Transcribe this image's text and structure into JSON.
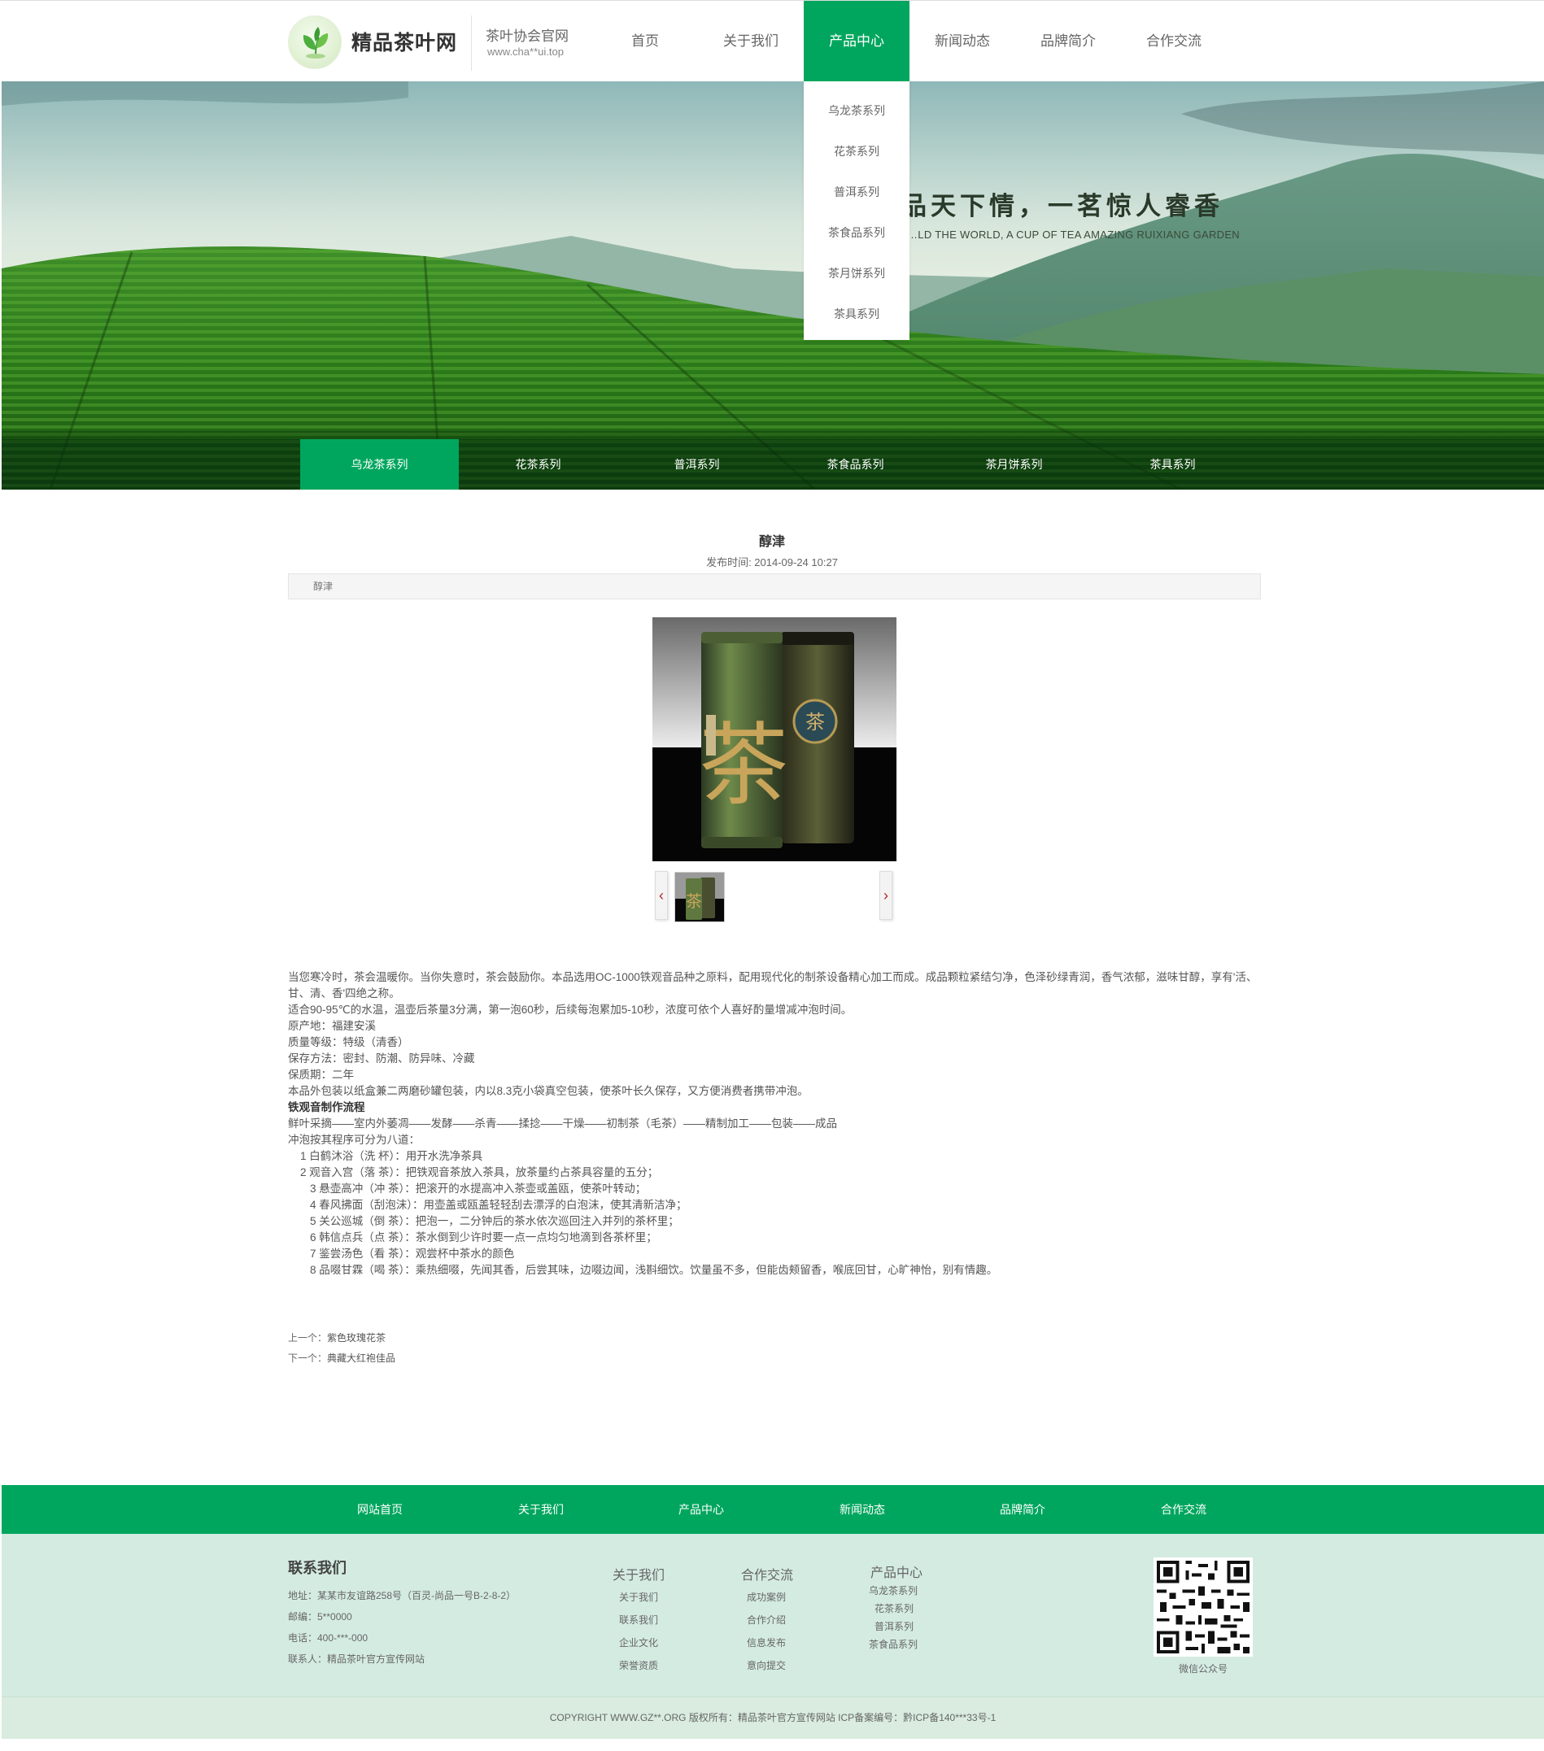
{
  "header": {
    "brand": "精品茶叶网",
    "association": "茶叶协会官网",
    "domain": "www.cha**ui.top",
    "nav": [
      {
        "label": "首页",
        "active": false
      },
      {
        "label": "关于我们",
        "active": false
      },
      {
        "label": "产品中心",
        "active": true
      },
      {
        "label": "新闻动态",
        "active": false
      },
      {
        "label": "品牌简介",
        "active": false
      },
      {
        "label": "合作交流",
        "active": false
      }
    ],
    "dropdown": [
      "乌龙茶系列",
      "花茶系列",
      "普洱系列",
      "茶食品系列",
      "茶月饼系列",
      "茶具系列"
    ]
  },
  "banner": {
    "slogan": "品天下情，一茗惊人睿香",
    "slogan_en": "…LD THE WORLD, A CUP OF TEA AMAZING RUIXIANG GARDEN",
    "categories": [
      {
        "label": "乌龙茶系列",
        "active": true
      },
      {
        "label": "花茶系列",
        "active": false
      },
      {
        "label": "普洱系列",
        "active": false
      },
      {
        "label": "茶食品系列",
        "active": false
      },
      {
        "label": "茶月饼系列",
        "active": false
      },
      {
        "label": "茶具系列",
        "active": false
      }
    ]
  },
  "article": {
    "title": "醇津",
    "date_label": "发布时间: 2014-09-24 10:27",
    "breadcrumb": "醇津",
    "prev_arrow": "‹",
    "next_arrow": "›",
    "paragraphs": [
      "当您寒冷时，茶会温暖你。当你失意时，茶会鼓励你。本品选用OC-1000铁观音品种之原料，配用现代化的制茶设备精心加工而成。成品颗粒紧结匀净，色泽砂绿青润，香气浓郁，滋味甘醇，享有'活、甘、清、香'四绝之称。",
      "适合90-95℃的水温，温壶后茶量3分满，第一泡60秒，后续每泡累加5-10秒，浓度可依个人喜好酌量增减冲泡时间。",
      "原产地：福建安溪",
      "质量等级：特级（清香）",
      "保存方法：密封、防潮、防异味、冷藏",
      "保质期：二年",
      "本品外包装以纸盒兼二两磨砂罐包装，内以8.3克小袋真空包装，使茶叶长久保存，又方便消费者携带冲泡。"
    ],
    "process_title": "铁观音制作流程",
    "process_steps": "鲜叶采摘——室内外萎凋——发酵——杀青——揉捻——干燥——初制茶（毛茶）——精制加工——包装——成品",
    "brew_intro": "冲泡按其程序可分为八道：",
    "brew_steps": [
      "1 白鹤沐浴（洗 杯）：用开水洗净茶具",
      "2 观音入宫（落 茶）：把铁观音茶放入茶具，放茶量约占茶具容量的五分；",
      "3 悬壶高冲（冲 茶）：把滚开的水提高冲入茶壶或盖瓯，使茶叶转动；",
      "4 春风拂面（刮泡沫）：用壶盖或瓯盖轻轻刮去漂浮的白泡沫，使其清新洁净；",
      "5 关公巡城（倒 茶）：把泡一，二分钟后的茶水依次巡回注入并列的茶杯里；",
      "6 韩信点兵（点 茶）：茶水倒到少许时要一点一点均匀地滴到各茶杯里；",
      "7 鉴尝汤色（看 茶）：观尝杯中茶水的颜色",
      "8 品啜甘霖（喝 茶）：乘热细啜，先闻其香，后尝其味，边啜边闻，浅斟细饮。饮量虽不多，但能齿颊留香，喉底回甘，心旷神怡，别有情趣。"
    ],
    "prev_label": "上一个：",
    "prev_value": "紫色玫瑰花茶",
    "next_label": "下一个：",
    "next_value": "典藏大红袍佳品"
  },
  "footer": {
    "nav": [
      "网站首页",
      "关于我们",
      "产品中心",
      "新闻动态",
      "品牌简介",
      "合作交流"
    ],
    "contact_title": "联系我们",
    "contact_lines": [
      "地址：某某市友谊路258号（百灵-尚品一号B-2-8-2）",
      "邮编：5**0000",
      "电话：400-***-000",
      "联系人：精品茶叶官方宣传网站"
    ],
    "col_about": {
      "title": "关于我们",
      "items": [
        "关于我们",
        "联系我们",
        "企业文化",
        "荣誉资质"
      ]
    },
    "col_coop": {
      "title": "合作交流",
      "items": [
        "成功案例",
        "合作介绍",
        "信息发布",
        "意向提交"
      ]
    },
    "col_products": {
      "title": "产品中心",
      "items": [
        "乌龙茶系列",
        "花茶系列",
        "普洱系列",
        "茶食品系列"
      ]
    },
    "qr_label": "微信公众号",
    "copyright": "COPYRIGHT WWW.GZ**.ORG    版权所有：精品茶叶官方宣传网站    ICP备案编号：黔ICP备140***33号-1"
  },
  "colors": {
    "accent": "#00a65e",
    "footer_bg": "#d4ebe2"
  }
}
